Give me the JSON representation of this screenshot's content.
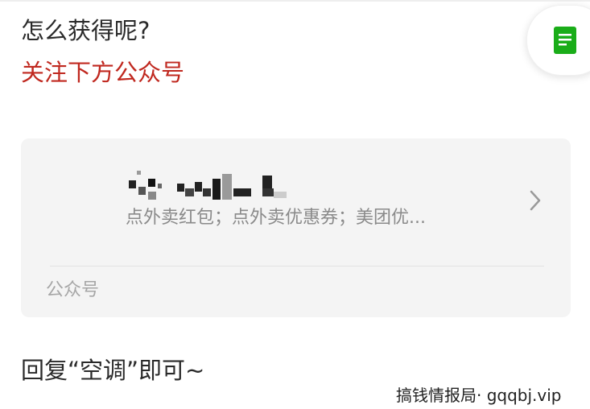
{
  "article": {
    "question": "怎么获得呢?",
    "follow_prompt": "关注下方公众号",
    "reply_instruction": "回复“空调”即可~"
  },
  "account_card": {
    "name": "",
    "description": "点外卖红包；点外卖优惠券；美团优...",
    "type_label": "公众号",
    "name_obscured": true
  },
  "floating_button": {
    "icon": "document-icon",
    "icon_color": "#1aad19"
  },
  "colors": {
    "accent_red": "#c0281f",
    "card_bg": "#f4f4f4",
    "muted_text": "#8a8a8a"
  },
  "watermark": {
    "text": "搞钱情报局· gqqbj.vip"
  }
}
